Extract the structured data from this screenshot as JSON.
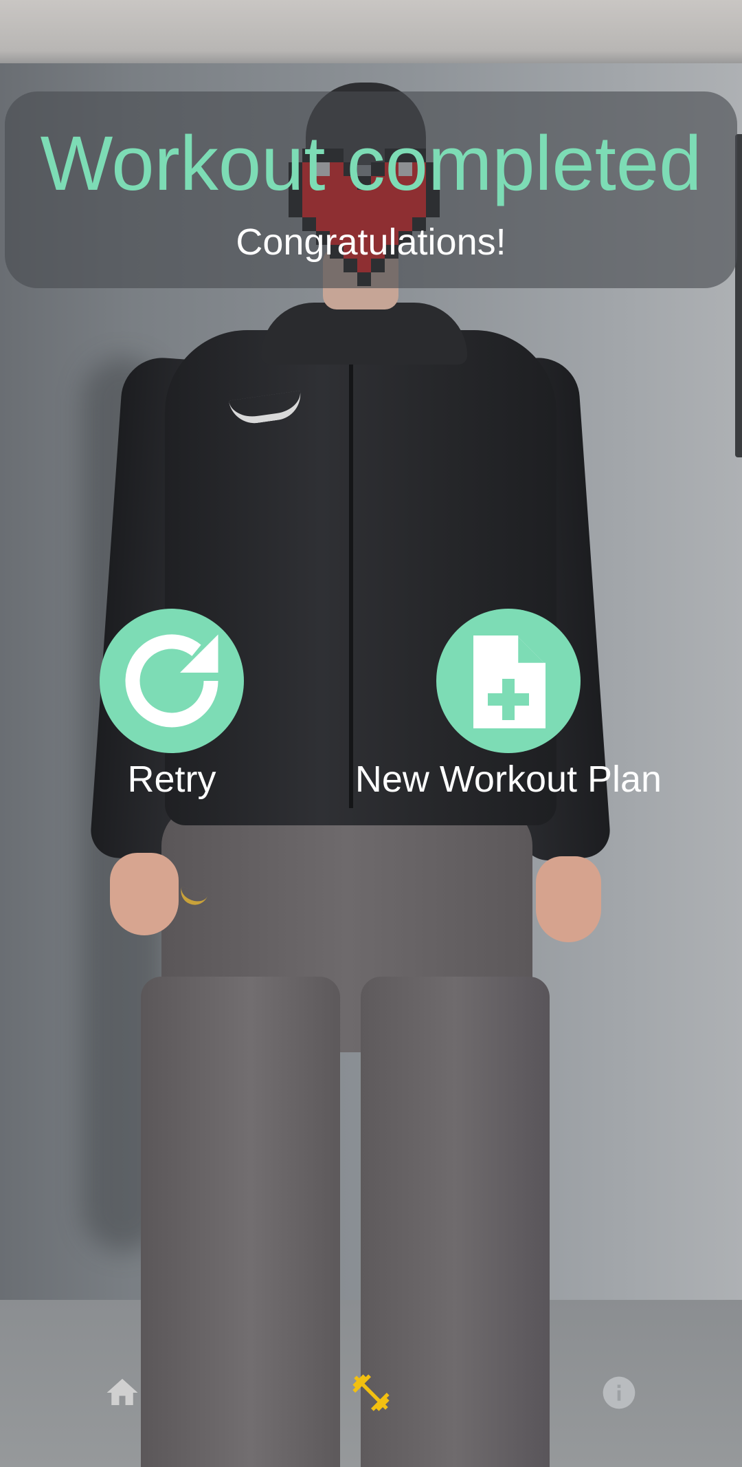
{
  "header": {
    "title": "Workout completed",
    "subtitle": "Congratulations!"
  },
  "actions": {
    "retry": {
      "label": "Retry",
      "icon": "retry-icon"
    },
    "new_plan": {
      "label": "New Workout Plan",
      "icon": "new-document-icon"
    }
  },
  "bottom_nav": {
    "items": [
      {
        "id": "home",
        "icon": "home-icon",
        "active": false
      },
      {
        "id": "workout",
        "icon": "dumbbell-icon",
        "active": true
      },
      {
        "id": "info",
        "icon": "info-icon",
        "active": false
      }
    ]
  },
  "colors": {
    "accent": "#7ddcb5",
    "nav_active": "#f2c011",
    "nav_inactive": "#d0d0d0",
    "panel": "#484c50"
  }
}
